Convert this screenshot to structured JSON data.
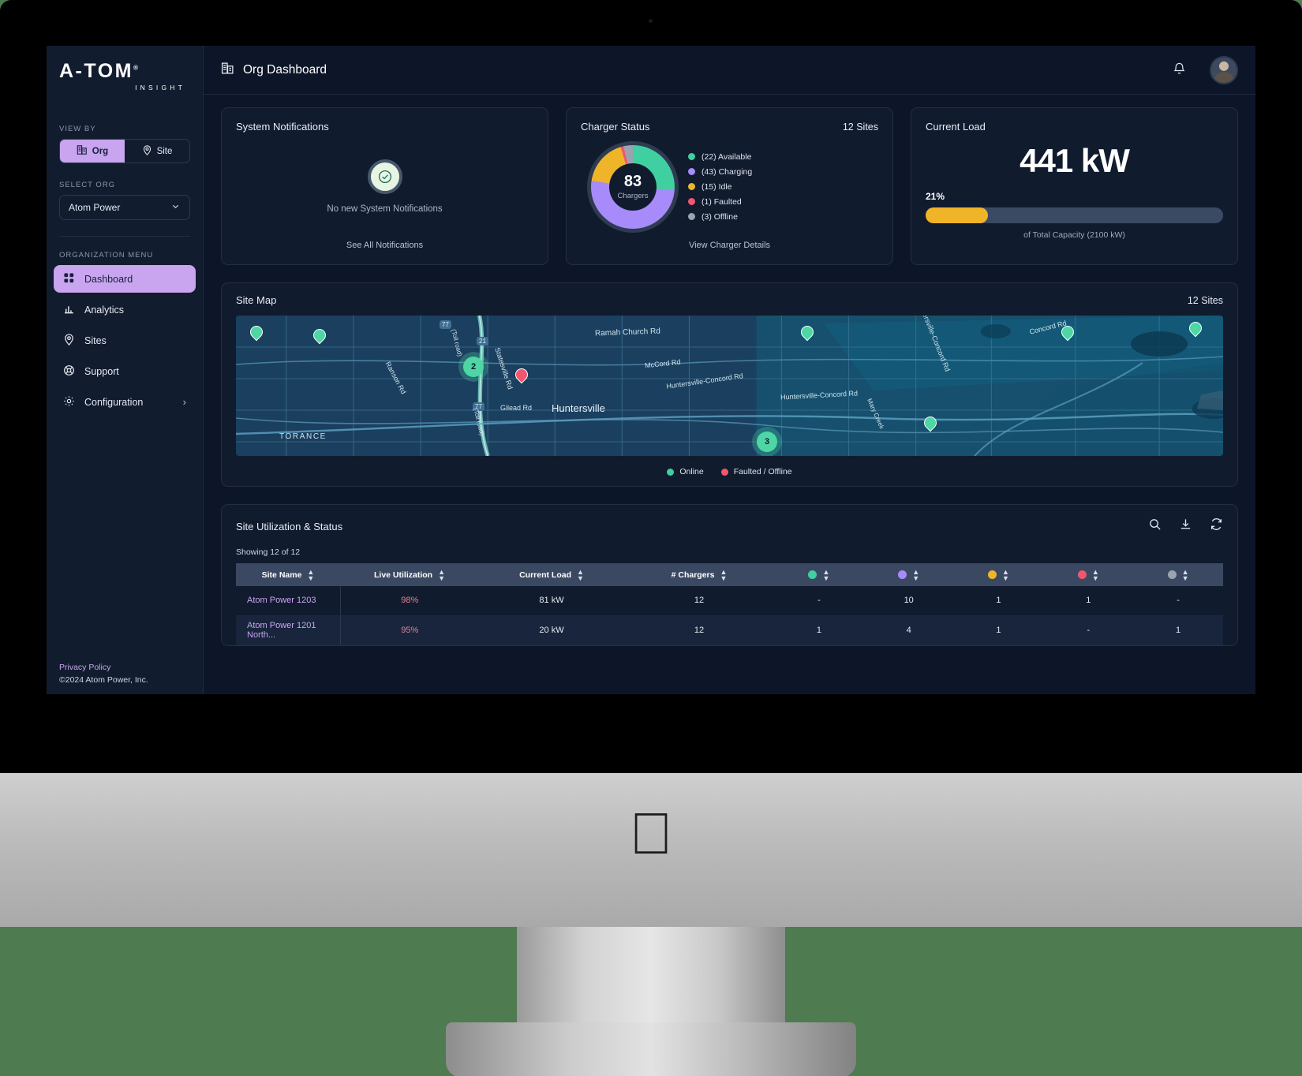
{
  "sidebar": {
    "logo": {
      "brand": "A-TOM",
      "trademark": "®",
      "sub": "INSIGHT"
    },
    "view_by_label": "VIEW BY",
    "view_by_options": [
      {
        "label": "Org",
        "icon": "building-icon",
        "active": true
      },
      {
        "label": "Site",
        "icon": "map-pin-icon",
        "active": false
      }
    ],
    "select_org_label": "SELECT ORG",
    "selected_org": "Atom Power",
    "org_menu_label": "ORGANIZATION MENU",
    "menu": [
      {
        "label": "Dashboard",
        "icon": "grid-icon",
        "active": true
      },
      {
        "label": "Analytics",
        "icon": "bar-chart-icon",
        "active": false
      },
      {
        "label": "Sites",
        "icon": "map-pin-icon",
        "active": false
      },
      {
        "label": "Support",
        "icon": "lifebuoy-icon",
        "active": false
      },
      {
        "label": "Configuration",
        "icon": "gear-icon",
        "active": false,
        "chevron": "›"
      }
    ],
    "privacy_policy": "Privacy Policy",
    "copyright": "©2024 Atom Power, Inc."
  },
  "topbar": {
    "title": "Org Dashboard",
    "icon": "building-icon"
  },
  "notifications": {
    "title": "System Notifications",
    "empty_text": "No new System Notifications",
    "link": "See All Notifications"
  },
  "charger_status": {
    "title": "Charger Status",
    "sites": "12 Sites",
    "center_value": "83",
    "center_label": "Chargers",
    "link": "View Charger Details",
    "legend": [
      {
        "label": "(22) Available",
        "count": 22,
        "color": "#3fcfa0"
      },
      {
        "label": "(43) Charging",
        "count": 43,
        "color": "#a78bfa"
      },
      {
        "label": "(15) Idle",
        "count": 15,
        "color": "#f0b429"
      },
      {
        "label": "(1) Faulted",
        "count": 1,
        "color": "#f2566f"
      },
      {
        "label": "(3) Offline",
        "count": 3,
        "color": "#9aa3b0"
      }
    ]
  },
  "current_load": {
    "title": "Current Load",
    "value": "441 kW",
    "percent_label": "21%",
    "percent": 21,
    "capacity_note": "of Total Capacity (2100 kW)"
  },
  "site_map": {
    "title": "Site Map",
    "sites": "12 Sites",
    "legend": [
      {
        "label": "Online",
        "color": "#3fcfa0"
      },
      {
        "label": "Faulted / Offline",
        "color": "#f2566f"
      }
    ],
    "labels": [
      "Ramah Church Rd",
      "Huntersville",
      "TORANCE",
      "Gilead Rd",
      "Ranson Rd",
      "Statesville Rd",
      "Huntersville-Concord Rd",
      "Huntersville Concord Rd",
      "Concord Rd",
      "McCord Rd",
      "(Toll road)"
    ],
    "clusters": [
      "2",
      "3"
    ]
  },
  "site_table": {
    "title": "Site Utilization & Status",
    "actions": [
      {
        "name": "search-icon",
        "glyph": "search"
      },
      {
        "name": "download-icon",
        "glyph": "download"
      },
      {
        "name": "refresh-icon",
        "glyph": "refresh"
      }
    ],
    "showing": "Showing 12 of 12",
    "columns": [
      {
        "label": "Site Name",
        "sortable": true
      },
      {
        "label": "Live Utilization",
        "sortable": true
      },
      {
        "label": "Current Load",
        "sortable": true
      },
      {
        "label": "# Chargers",
        "sortable": true
      },
      {
        "label": "",
        "dot": "#3fcfa0",
        "sortable": true
      },
      {
        "label": "",
        "dot": "#a78bfa",
        "sortable": true
      },
      {
        "label": "",
        "dot": "#f0b429",
        "sortable": true
      },
      {
        "label": "",
        "dot": "#f2566f",
        "sortable": true
      },
      {
        "label": "",
        "dot": "#9aa3b0",
        "sortable": true
      }
    ],
    "rows": [
      {
        "site": "Atom Power 1203",
        "utilization": "98%",
        "load": "81 kW",
        "chargers": "12",
        "available": "-",
        "charging": "10",
        "idle": "1",
        "faulted": "1",
        "offline": "-"
      },
      {
        "site": "Atom Power 1201 North...",
        "utilization": "95%",
        "load": "20 kW",
        "chargers": "12",
        "available": "1",
        "charging": "4",
        "idle": "1",
        "faulted": "-",
        "offline": "1"
      }
    ]
  }
}
